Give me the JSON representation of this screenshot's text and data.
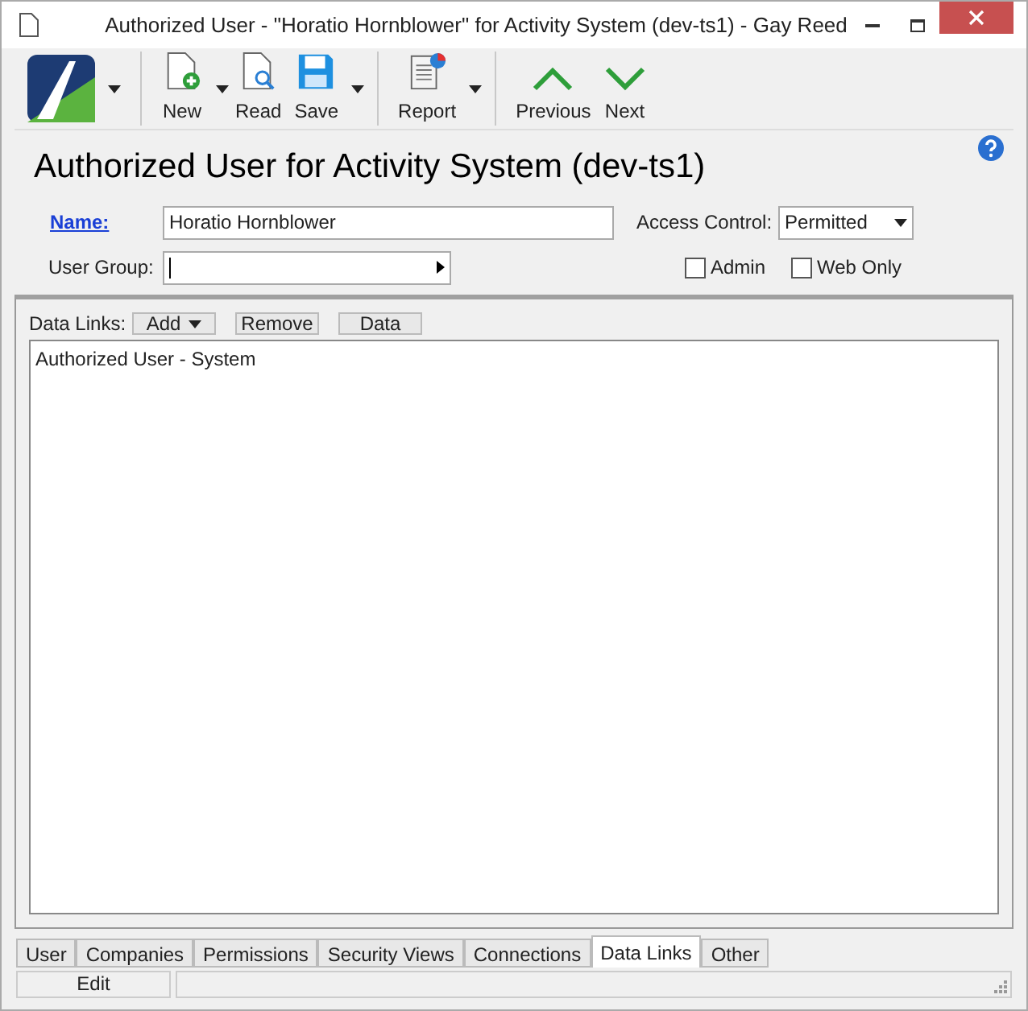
{
  "window": {
    "title": "Authorized User - \"Horatio Hornblower\" for Activity System (dev-ts1) - Gay Reed"
  },
  "toolbar": [
    {
      "kind": "logo"
    },
    {
      "kind": "new",
      "label": "New"
    },
    {
      "kind": "read",
      "label": "Read"
    },
    {
      "kind": "save",
      "label": "Save"
    },
    {
      "kind": "report",
      "label": "Report"
    },
    {
      "kind": "previous",
      "label": "Previous"
    },
    {
      "kind": "next",
      "label": "Next"
    }
  ],
  "heading": "Authorized User for Activity System (dev-ts1)",
  "form": {
    "name_label": "Name:",
    "name_value": "Horatio Hornblower",
    "group_label": "User Group:",
    "access_label": "Access Control:",
    "access_value": "Permitted",
    "checkboxes": [
      {
        "label": "Admin",
        "checked": false
      },
      {
        "label": "Web Only",
        "checked": false
      }
    ]
  },
  "data_links": {
    "label": "Data Links:",
    "buttons": [
      "Add",
      "Remove",
      "Data"
    ],
    "items": [
      "Authorized User - System"
    ]
  },
  "tabs": [
    {
      "label": "User",
      "selected": false
    },
    {
      "label": "Companies",
      "selected": false
    },
    {
      "label": "Permissions",
      "selected": false
    },
    {
      "label": "Security Views",
      "selected": false
    },
    {
      "label": "Connections",
      "selected": false
    },
    {
      "label": "Data Links",
      "selected": true
    },
    {
      "label": "Other",
      "selected": false
    }
  ],
  "status_bar": {
    "mode": "Edit"
  }
}
